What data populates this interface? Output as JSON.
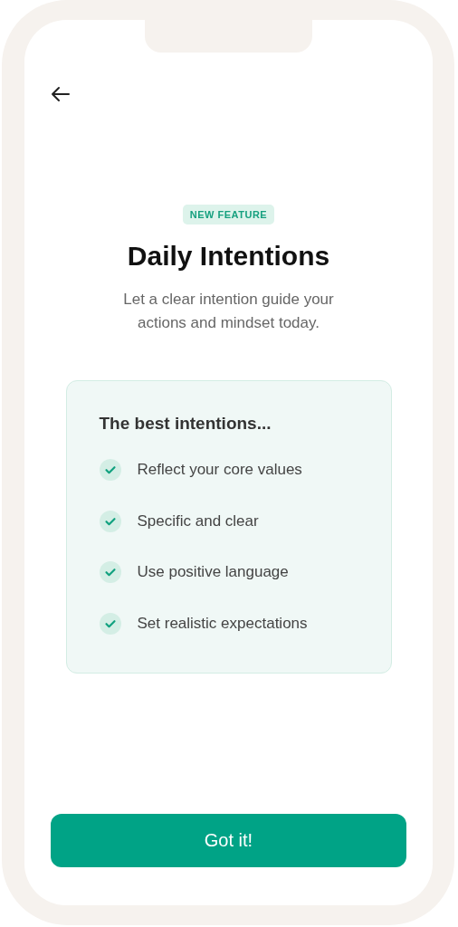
{
  "badge": "NEW FEATURE",
  "title": "Daily Intentions",
  "subtitle": "Let a clear intention guide your actions and mindset today.",
  "card": {
    "heading": "The best intentions...",
    "items": [
      {
        "label": "Reflect your core values",
        "checked": true
      },
      {
        "label": "Specific and clear",
        "checked": true
      },
      {
        "label": "Use positive language",
        "checked": true
      },
      {
        "label": "Set realistic expectations",
        "checked": true
      }
    ]
  },
  "primary_button": "Got it!"
}
